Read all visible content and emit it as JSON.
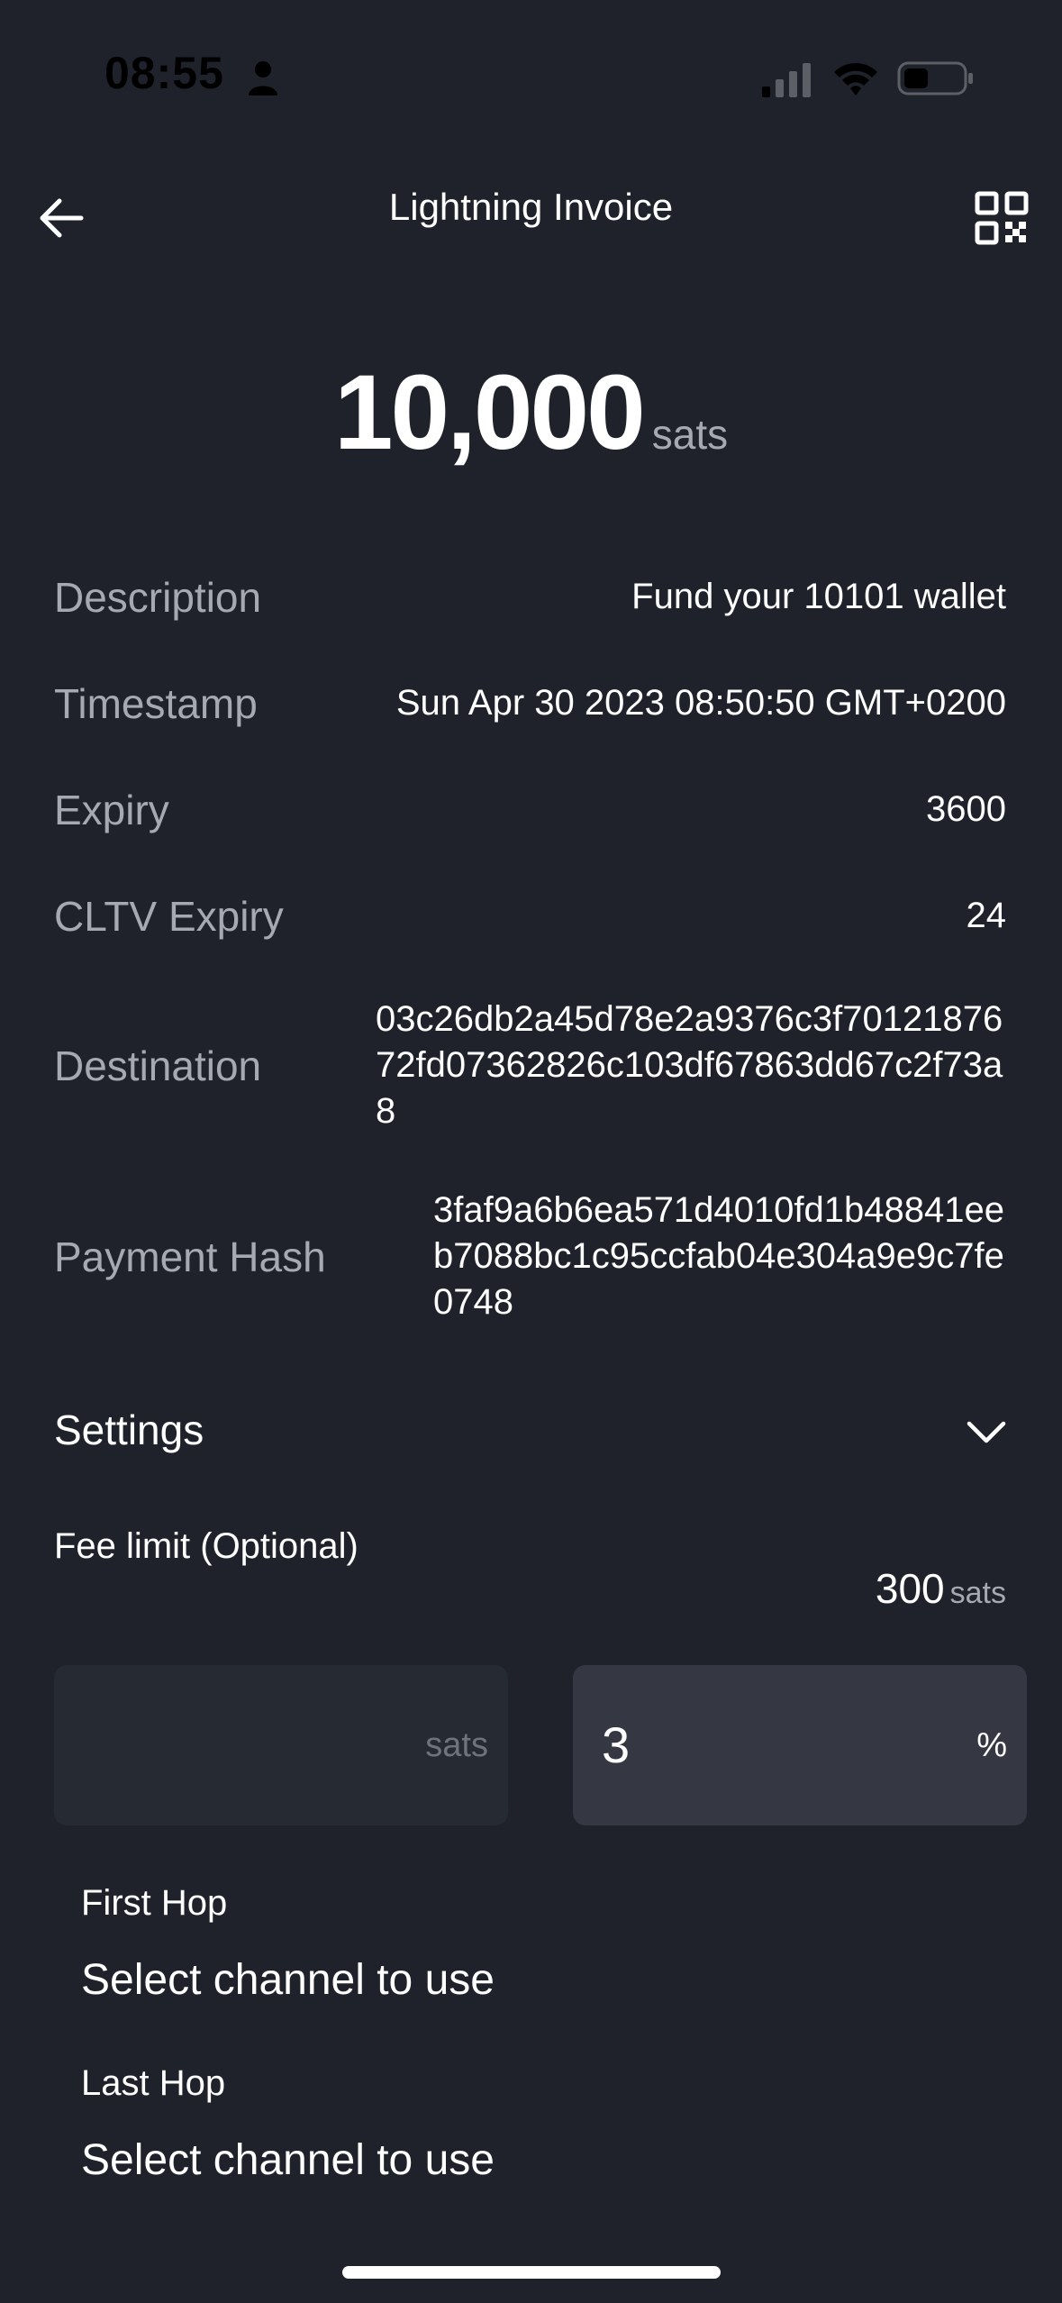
{
  "status_bar": {
    "time": "08:55",
    "icons": [
      "person-icon",
      "signal-icon",
      "wifi-icon",
      "battery-icon"
    ]
  },
  "header": {
    "title": "Lightning Invoice",
    "back_icon": "arrow-left-icon",
    "qr_icon": "qr-code-icon"
  },
  "amount": {
    "value": "10,000",
    "unit": "sats"
  },
  "details": [
    {
      "label": "Description",
      "value": "Fund your 10101 wallet"
    },
    {
      "label": "Timestamp",
      "value": "Sun Apr 30 2023 08:50:50 GMT+0200"
    },
    {
      "label": "Expiry",
      "value": "3600"
    },
    {
      "label": "CLTV Expiry",
      "value": "24"
    },
    {
      "label": "Destination",
      "value": "03c26db2a45d78e2a9376c3f7012187672fd07362826c103df67863dd67c2f73a8"
    },
    {
      "label": "Payment Hash",
      "value": "3faf9a6b6ea571d4010fd1b48841eeb7088bc1c95ccfab04e304a9e9c7fe0748"
    }
  ],
  "settings": {
    "label": "Settings",
    "fee_limit_label": "Fee limit (Optional)",
    "fee_value": "300",
    "fee_unit": "sats",
    "sats_field": {
      "value": "",
      "suffix": "sats"
    },
    "percent_field": {
      "value": "3",
      "suffix": "%"
    },
    "first_hop_label": "First Hop",
    "first_hop_value": "Select channel to use",
    "last_hop_label": "Last Hop",
    "last_hop_value": "Select channel to use"
  },
  "colors": {
    "background": "#1f222b",
    "label": "#a6a9b1",
    "input_bg": "#262a33",
    "input_active_bg": "#353843"
  }
}
